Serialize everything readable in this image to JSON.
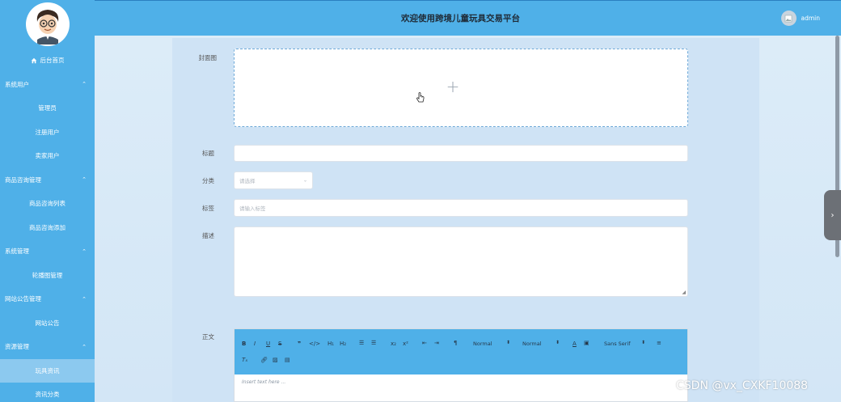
{
  "header": {
    "title": "欢迎使用跨境儿童玩具交易平台",
    "username": "admin"
  },
  "sidebar": {
    "home": "后台首页",
    "items": [
      {
        "label": "系统用户",
        "type": "group"
      },
      {
        "label": "管理员",
        "type": "sub"
      },
      {
        "label": "注册用户",
        "type": "sub"
      },
      {
        "label": "卖家用户",
        "type": "sub"
      },
      {
        "label": "商品咨询管理",
        "type": "group"
      },
      {
        "label": "商品咨询列表",
        "type": "sub"
      },
      {
        "label": "商品咨询添加",
        "type": "sub"
      },
      {
        "label": "系统管理",
        "type": "group"
      },
      {
        "label": "轮播图管理",
        "type": "sub"
      },
      {
        "label": "网站公告管理",
        "type": "group"
      },
      {
        "label": "网站公告",
        "type": "sub"
      },
      {
        "label": "资源管理",
        "type": "group"
      },
      {
        "label": "玩具资讯",
        "type": "sub",
        "active": true
      },
      {
        "label": "资讯分类",
        "type": "sub"
      }
    ]
  },
  "form": {
    "cover_label": "封面图",
    "title_label": "标题",
    "category_label": "分类",
    "category_placeholder": "请选择",
    "tags_label": "标签",
    "tags_placeholder": "请输入标签",
    "desc_label": "描述",
    "content_label": "正文"
  },
  "editor": {
    "header1": "H₁",
    "header2": "H₂",
    "format_normal_1": "Normal",
    "format_normal_2": "Normal",
    "font": "Sans Serif",
    "placeholder": "Insert text here ..."
  },
  "watermark": "CSDN @vx_CXKF10088",
  "colors": {
    "primary": "#4fb0e8",
    "active": "#8cc9ef"
  }
}
